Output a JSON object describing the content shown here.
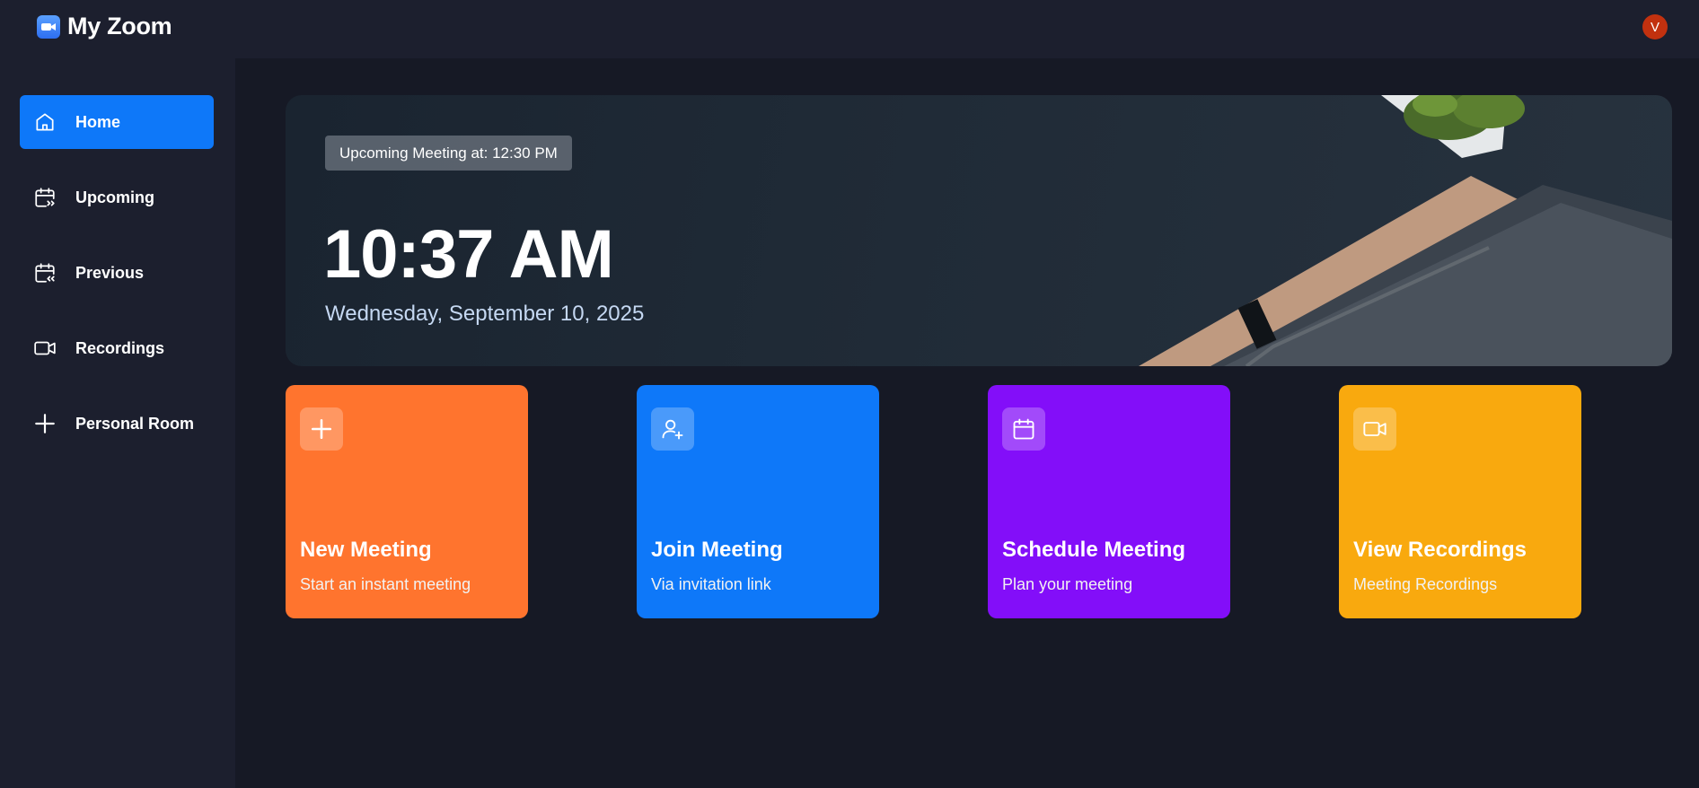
{
  "app": {
    "title": "My Zoom"
  },
  "user": {
    "avatar_initial": "V"
  },
  "sidebar": {
    "items": [
      {
        "label": "Home",
        "icon": "home-icon",
        "active": true
      },
      {
        "label": "Upcoming",
        "icon": "calendar-forward-icon",
        "active": false
      },
      {
        "label": "Previous",
        "icon": "calendar-back-icon",
        "active": false
      },
      {
        "label": "Recordings",
        "icon": "video-icon",
        "active": false
      },
      {
        "label": "Personal Room",
        "icon": "plus-icon",
        "active": false
      }
    ]
  },
  "hero": {
    "badge": "Upcoming Meeting at: 12:30 PM",
    "time": "10:37 AM",
    "date": "Wednesday, September 10, 2025"
  },
  "cards": [
    {
      "title": "New Meeting",
      "subtitle": "Start an instant meeting",
      "icon": "plus-icon",
      "color": "#ff742e"
    },
    {
      "title": "Join Meeting",
      "subtitle": "Via invitation link",
      "icon": "add-user-icon",
      "color": "#0e78f9"
    },
    {
      "title": "Schedule Meeting",
      "subtitle": "Plan your meeting",
      "icon": "calendar-icon",
      "color": "#830ef9"
    },
    {
      "title": "View Recordings",
      "subtitle": "Meeting Recordings",
      "icon": "video-icon",
      "color": "#f9a90e"
    }
  ],
  "colors": {
    "background": "#161925",
    "panel": "#1c1f2e",
    "accent": "#0e78f9"
  }
}
